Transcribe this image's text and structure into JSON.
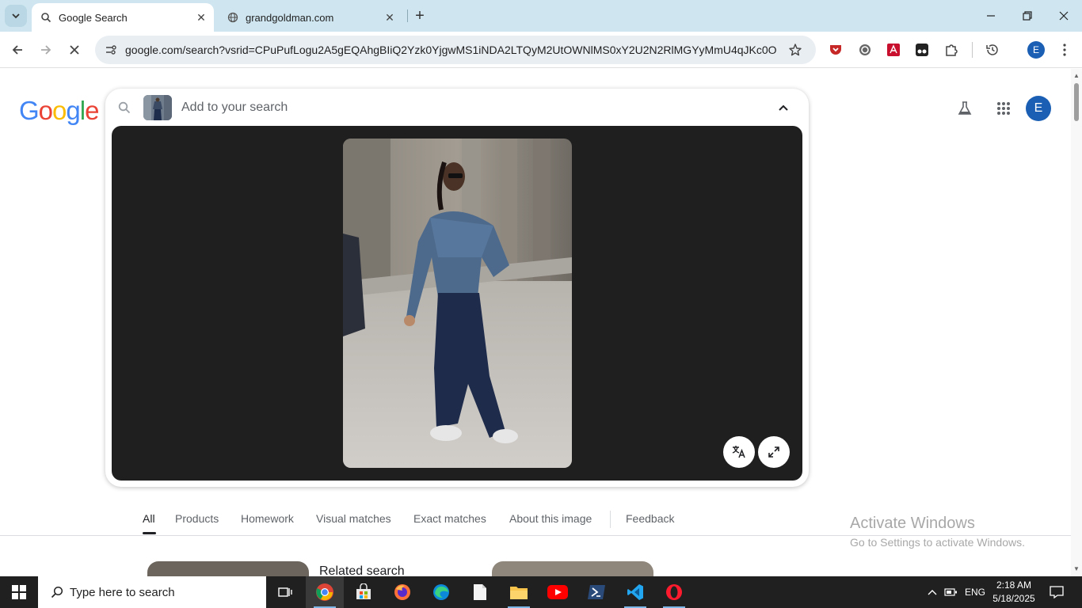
{
  "browser": {
    "tabs": [
      {
        "title": "Google Search",
        "active": true
      },
      {
        "title": "grandgoldman.com",
        "active": false
      }
    ],
    "url": "google.com/search?vsrid=CPuPufLogu2A5gEQAhgBIiQ2Yzk0YjgwMS1iNDA2LTQyM2UtOWNlMS0xY2U2N2RlMGYyMmU4qJKc0Oyrj...",
    "profile_initial": "E"
  },
  "page": {
    "logo": "Google",
    "search": {
      "placeholder": "Add to your search"
    },
    "avatar_initial": "E",
    "tabs": [
      {
        "label": "All",
        "active": true
      },
      {
        "label": "Products"
      },
      {
        "label": "Homework"
      },
      {
        "label": "Visual matches"
      },
      {
        "label": "Exact matches"
      },
      {
        "label": "About this image"
      },
      {
        "label": "Feedback"
      }
    ],
    "related_title": "Related search",
    "watermark": {
      "line1": "Activate Windows",
      "line2": "Go to Settings to activate Windows."
    }
  },
  "taskbar": {
    "search_placeholder": "Type here to search",
    "language": "ENG",
    "time": "2:18 AM",
    "date": "5/18/2025"
  },
  "colors": {
    "google_blue": "#4285F4",
    "google_red": "#EA4335",
    "google_yellow": "#FBBC05",
    "google_green": "#34A853",
    "viewer_bg": "#1f1f1f",
    "tabstrip_bg": "#cfe6f0"
  }
}
